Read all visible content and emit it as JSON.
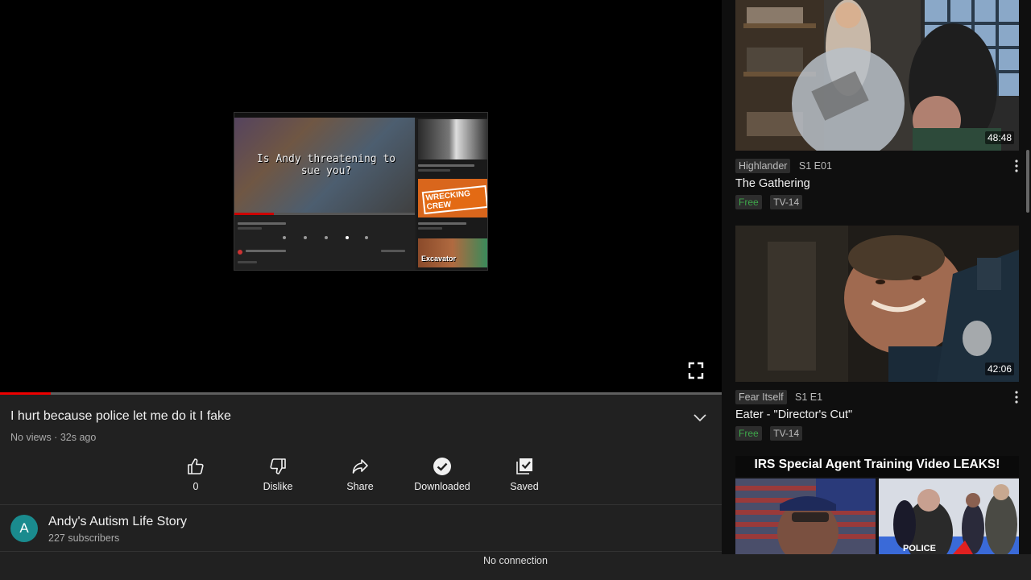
{
  "video": {
    "title": "I hurt because police let me do it I fake",
    "meta": "No views · 32s ago",
    "progress_fraction": 0.07,
    "preview_overlay_text": "Is Andy threatening to sue you?",
    "preview_thumb2_text": "WRECKING CREW",
    "preview_thumb3_text": "Excavator"
  },
  "actions": [
    {
      "label": "0",
      "icon": "thumbs-up-icon"
    },
    {
      "label": "Dislike",
      "icon": "thumbs-down-icon"
    },
    {
      "label": "Share",
      "icon": "share-icon"
    },
    {
      "label": "Downloaded",
      "icon": "downloaded-check-icon"
    },
    {
      "label": "Saved",
      "icon": "saved-playlist-icon"
    }
  ],
  "channel": {
    "avatar_letter": "A",
    "avatar_color": "#1a8b8e",
    "name": "Andy's Autism Life Story",
    "subscribers": "227 subscribers"
  },
  "status": {
    "no_connection": "No connection"
  },
  "recommendations": [
    {
      "duration": "48:48",
      "show": "Highlander",
      "episode": "S1 E01",
      "title": "The Gathering",
      "free": "Free",
      "rating": "TV-14"
    },
    {
      "duration": "42:06",
      "show": "Fear Itself",
      "episode": "S1 E1",
      "title": "Eater - \"Director's Cut\"",
      "free": "Free",
      "rating": "TV-14"
    },
    {
      "thumb_text": "IRS Special Agent Training Video LEAKS!"
    }
  ],
  "colors": {
    "accent_red": "#ff0000",
    "free_green": "#3ea64a",
    "background": "#212121"
  }
}
